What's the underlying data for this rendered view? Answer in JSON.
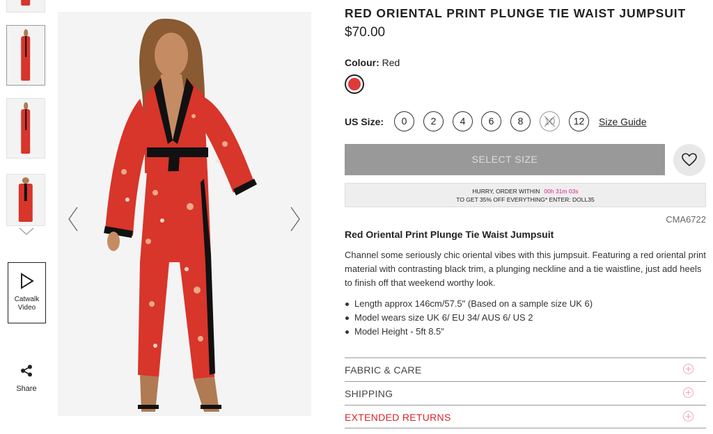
{
  "product": {
    "title": "RED ORIENTAL PRINT PLUNGE TIE WAIST JUMPSUIT",
    "price": "$70.00",
    "colour_label": "Colour:",
    "colour_value": "Red",
    "swatch_color": "#e0393a",
    "code": "CMA6722"
  },
  "sizes": {
    "label": "US Size:",
    "options": [
      "0",
      "2",
      "4",
      "6",
      "8",
      "10",
      "12"
    ],
    "unavailable": [
      "10"
    ],
    "guide_label": "Size Guide"
  },
  "actions": {
    "select_size_label": "SELECT SIZE",
    "wishlist_icon": "heart-icon"
  },
  "promo": {
    "line1": "HURRY, ORDER WITHIN",
    "timer": "00h 31m 03s",
    "line2": "TO GET 35% OFF EVERYTHING* ENTER: DOLL35",
    "timer_color": "#e0218a"
  },
  "description": {
    "title": "Red Oriental Print Plunge Tie Waist Jumpsuit",
    "body": "Channel some seriously chic oriental vibes with this jumpsuit. Featuring a red oriental print material with contrasting black trim, a plunging neckline and a tie waistline, just add heels to finish off that weekend worthy look.",
    "bullets": [
      "Length approx 146cm/57.5\" (Based on a sample size UK 6)",
      "Model wears size UK 6/ EU 34/ AUS 6/ US 2",
      "Model Height - 5ft 8.5\""
    ]
  },
  "accordion": [
    {
      "label": "FABRIC & CARE"
    },
    {
      "label": "SHIPPING"
    },
    {
      "label": "EXTENDED RETURNS",
      "color": "#d9222a"
    }
  ],
  "sidebar": {
    "catwalk_label_1": "Catwalk",
    "catwalk_label_2": "Video",
    "share_label": "Share"
  }
}
